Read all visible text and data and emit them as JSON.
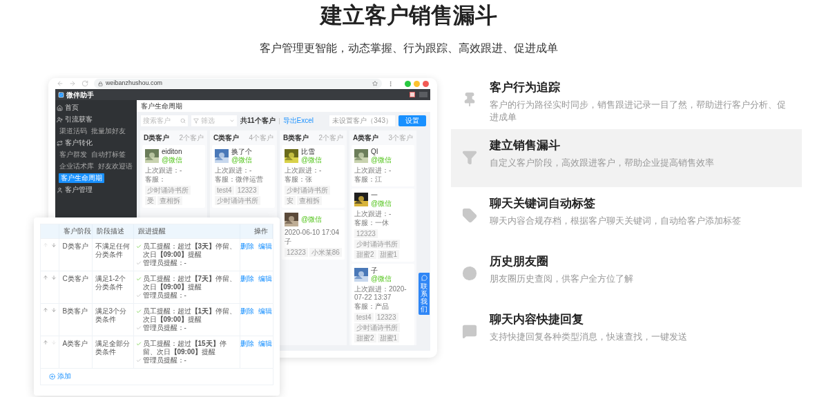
{
  "page": {
    "title": "建立客户销售漏斗",
    "subtitle": "客户管理更智能，动态掌握、行为跟踪、高效跟进、促进成单"
  },
  "browser": {
    "url": "weibanzhushou.com"
  },
  "app": {
    "brand": "微伴助手",
    "sidebar": [
      {
        "kind": "section",
        "label": "首页"
      },
      {
        "kind": "section",
        "label": "引流获客"
      },
      {
        "kind": "links",
        "items": [
          {
            "label": "渠道活码",
            "selected": false
          },
          {
            "label": "批量加好友",
            "selected": false
          }
        ]
      },
      {
        "kind": "section",
        "label": "客户转化"
      },
      {
        "kind": "links",
        "items": [
          {
            "label": "客户群发",
            "selected": false
          },
          {
            "label": "自动打标签",
            "selected": false
          }
        ]
      },
      {
        "kind": "links",
        "items": [
          {
            "label": "企业话术库",
            "selected": false
          },
          {
            "label": "好友欢迎语",
            "selected": false
          }
        ]
      },
      {
        "kind": "links",
        "items": [
          {
            "label": "客户生命周期",
            "selected": true
          }
        ]
      },
      {
        "kind": "section",
        "label": "客户管理"
      }
    ],
    "board": {
      "title": "客户生命周期",
      "search_placeholder": "搜索客户",
      "filter_placeholder": "筛选",
      "total": "共11个客户",
      "export": "导出Excel",
      "unassigned": "未设置客户（343）",
      "settings_button": "设置",
      "columns": [
        {
          "title": "D类客户",
          "count": "2个客户",
          "cards": [
            {
              "name": "eiditon",
              "source": "@微信",
              "last_follow": "上次跟进：-",
              "agent": "客服：",
              "tags": [
                "少时诵诗书所",
                "受",
                "查相拆"
              ]
            }
          ]
        },
        {
          "title": "C类客户",
          "count": "4个客户",
          "cards": [
            {
              "name": "换了个",
              "source": "@微信",
              "last_follow": "上次跟进：-",
              "agent": "客服：微伴运营",
              "tags": [
                "test4",
                "12323",
                "少时诵诗书所"
              ]
            }
          ]
        },
        {
          "title": "B类客户",
          "count": "2个客户",
          "cards": [
            {
              "name": "比雪",
              "source": "@微信",
              "last_follow": "上次跟进：-",
              "agent": "客服：张",
              "tags": [
                "少时诵诗书所",
                "安",
                "查相拆"
              ]
            },
            {
              "source": "@微信",
              "last_follow": "2020-06-10 17:04",
              "agent": "子",
              "tags": [
                "12323",
                "小米某86"
              ]
            }
          ]
        },
        {
          "title": "A类客户",
          "count": "3个客户",
          "cards": [
            {
              "name": "QI",
              "source": "@微信",
              "last_follow": "上次跟进：-",
              "agent": "客服：江"
            },
            {
              "name": "一",
              "source": "@微信",
              "last_follow": "上次跟进：-",
              "agent": "客服：一休",
              "tags": [
                "12323",
                "少时诵诗书所",
                "甜蜜2",
                "甜蜜1"
              ]
            },
            {
              "name": "子",
              "source": "@微信",
              "last_follow": "上次跟进：2020-07-22 13:37",
              "agent": "客服：产品",
              "tags": [
                "test4",
                "12323",
                "少时诵诗书所",
                "甜蜜2",
                "甜蜜1"
              ]
            }
          ]
        }
      ]
    },
    "contact_tab": "联系我们"
  },
  "stages_table": {
    "columns": [
      "客户阶段",
      "阶段描述",
      "跟进提醒",
      "操作"
    ],
    "rows": [
      {
        "up_disabled": true,
        "down_disabled": false,
        "stage": "D类客户",
        "description": "不满足任何分类条件",
        "employee_reminder": {
          "enabled": true,
          "text": "员工提醒：超过**【3天】**停留、次日**【09:00】**提醒"
        },
        "admin_reminder": {
          "enabled": false,
          "text": "管理员提醒：-"
        },
        "actions": [
          "删除",
          "编辑"
        ]
      },
      {
        "up_disabled": false,
        "down_disabled": false,
        "stage": "C类客户",
        "description": "满足1-2个分类条件",
        "employee_reminder": {
          "enabled": true,
          "text": "员工提醒：超过**【7天】**停留、次日**【09:00】**提醒"
        },
        "admin_reminder": {
          "enabled": false,
          "text": "管理员提醒：-"
        },
        "actions": [
          "删除",
          "编辑"
        ]
      },
      {
        "up_disabled": false,
        "down_disabled": false,
        "stage": "B类客户",
        "description": "满足3个分类条件",
        "employee_reminder": {
          "enabled": true,
          "text": "员工提醒：超过**【1天】**停留、次日**【09:00】**提醒"
        },
        "admin_reminder": {
          "enabled": false,
          "text": "管理员提醒：-"
        },
        "actions": [
          "删除",
          "编辑"
        ]
      },
      {
        "up_disabled": false,
        "down_disabled": true,
        "stage": "A类客户",
        "description": "满足全部分类条件",
        "employee_reminder": {
          "enabled": true,
          "text": "员工提醒：超过**【15天】**停留、次日**【09:00】**提醒"
        },
        "admin_reminder": {
          "enabled": false,
          "text": "管理员提醒：-"
        },
        "actions": [
          "删除",
          "编辑"
        ]
      }
    ],
    "add_button": "添加"
  },
  "features": [
    {
      "title": "客户行为追踪",
      "description": "客户的行为路径实时同步，销售跟进记录一目了然，帮助进行客户分析、促进成单",
      "selected": false
    },
    {
      "title": "建立销售漏斗",
      "description": "自定义客户阶段，高效跟进客户，帮助企业提高销售效率",
      "selected": true
    },
    {
      "title": "聊天关键词自动标签",
      "description": "聊天内容合规存档，根据客户聊天关键词，自动给客户添加标签",
      "selected": false
    },
    {
      "title": "历史朋友圈",
      "description": "朋友圈历史查阅，供客户全方位了解",
      "selected": false
    },
    {
      "title": "聊天内容快捷回复",
      "description": "支持快捷回复各种类型消息，快速查找，一键发送",
      "selected": false
    }
  ]
}
